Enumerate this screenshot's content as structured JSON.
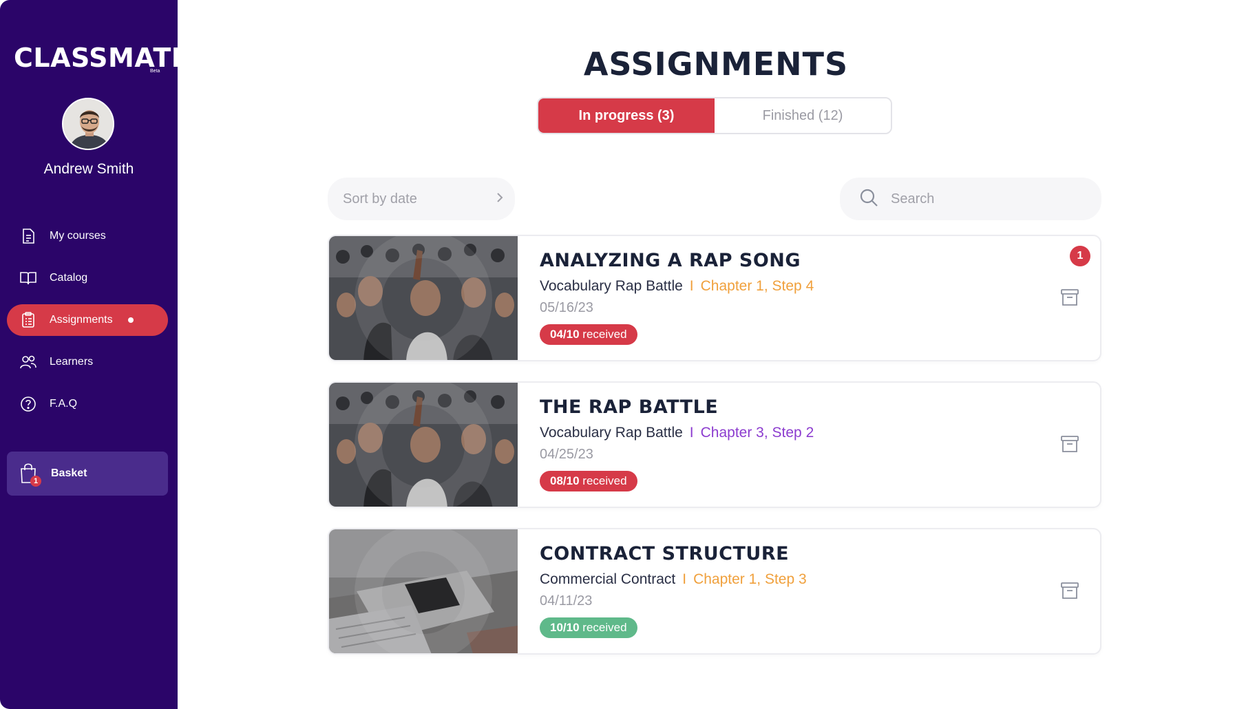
{
  "sidebar": {
    "logo": "CLASSMATE",
    "logo_tag": "Beta",
    "user_name": "Andrew Smith",
    "nav": [
      {
        "label": "My courses",
        "icon": "document-icon"
      },
      {
        "label": "Catalog",
        "icon": "book-icon"
      },
      {
        "label": "Assignments",
        "icon": "checklist-icon",
        "active": true
      },
      {
        "label": "Learners",
        "icon": "users-icon"
      },
      {
        "label": "F.A.Q",
        "icon": "help-icon"
      }
    ],
    "basket": {
      "label": "Basket",
      "count": "1"
    }
  },
  "main": {
    "title": "ASSIGNMENTS",
    "tabs": [
      {
        "label": "In progress (3)",
        "active": true
      },
      {
        "label": "Finished (12)",
        "active": false
      }
    ],
    "sort_label": "Sort by date",
    "search_placeholder": "Search",
    "assignments": [
      {
        "title": "ANALYZING A RAP SONG",
        "course": "Vocabulary Rap Battle",
        "separator": "I",
        "chapter": "Chapter 1, Step 4",
        "chapter_color": "#f0a03c",
        "date": "05/16/23",
        "received_count": "04/10",
        "received_label": "received",
        "pill_color": "#d63a48",
        "notification": "1",
        "image": "concert-crowd"
      },
      {
        "title": "THE RAP BATTLE",
        "course": "Vocabulary Rap Battle",
        "separator": "I",
        "chapter": "Chapter 3, Step 2",
        "chapter_color": "#8c3ccf",
        "date": "04/25/23",
        "received_count": "08/10",
        "received_label": "received",
        "pill_color": "#d63a48",
        "image": "concert-crowd"
      },
      {
        "title": "CONTRACT STRUCTURE",
        "course": "Commercial Contract",
        "separator": "I",
        "chapter": "Chapter 1, Step 3",
        "chapter_color": "#f0a03c",
        "date": "04/11/23",
        "received_count": "10/10",
        "received_label": "received",
        "pill_color": "#5fb98a",
        "image": "laptop-phone-desk"
      }
    ]
  },
  "colors": {
    "sidebar_bg": "#2b0569",
    "accent_red": "#d63a48",
    "success_green": "#5fb98a",
    "chapter_orange": "#f0a03c",
    "chapter_purple": "#8c3ccf"
  }
}
